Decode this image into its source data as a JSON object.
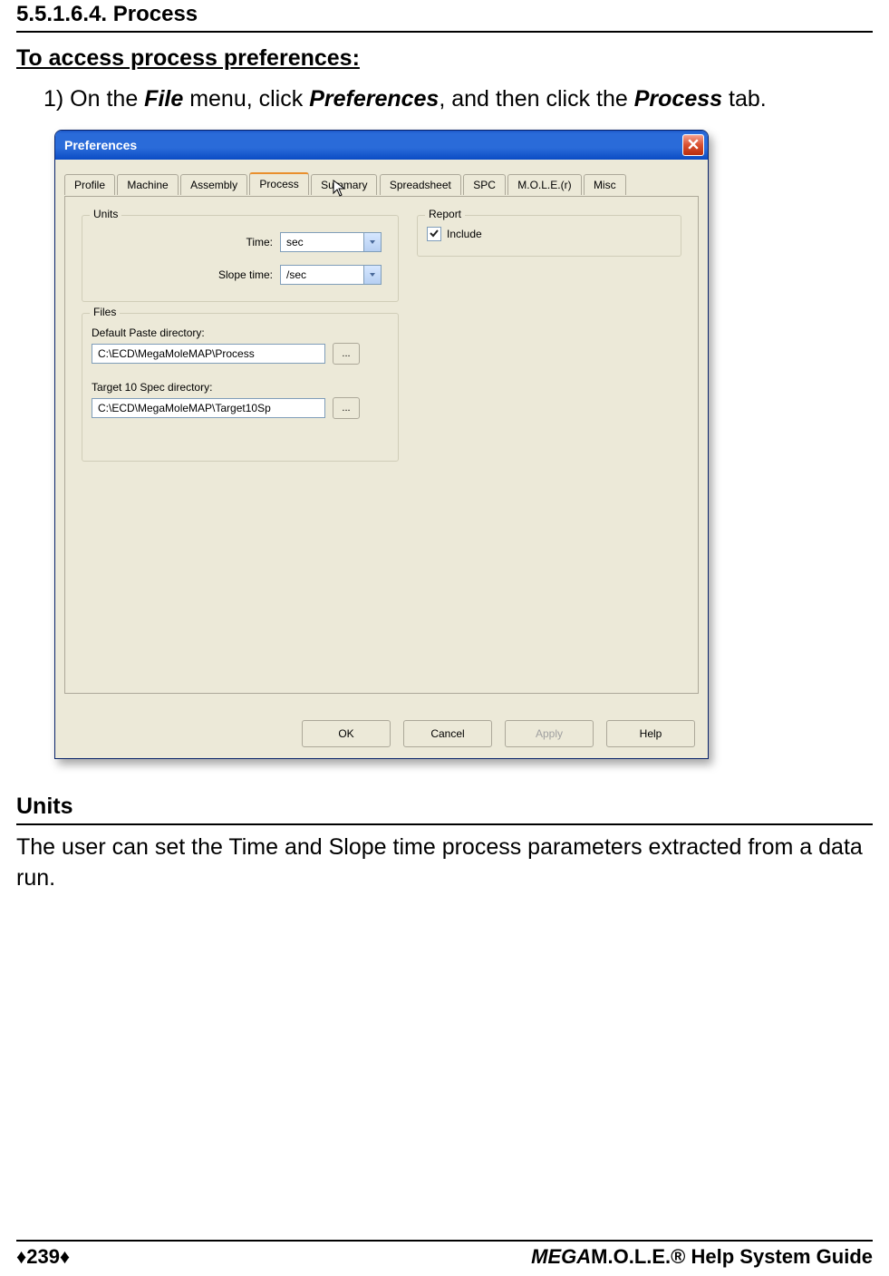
{
  "doc": {
    "section_number": "5.5.1.6.4. Process",
    "access_heading": "To access process preferences:",
    "instruction": {
      "prefix": "1) On the ",
      "bold1": "File",
      "mid1": " menu, click ",
      "bold2": "Preferences",
      "mid2": ", and then click the ",
      "bold3": "Process",
      "suffix": " tab."
    },
    "units_heading": "Units",
    "units_para": "The user can set the Time and Slope time process parameters extracted from a data run.",
    "footer_page": "♦239♦",
    "footer_mega": "MEGA",
    "footer_rest": "M.O.L.E.® Help System Guide"
  },
  "dialog": {
    "title": "Preferences",
    "tabs": [
      "Profile",
      "Machine",
      "Assembly",
      "Process",
      "Summary",
      "Spreadsheet",
      "SPC",
      "M.O.L.E.(r)",
      "Misc"
    ],
    "active_tab_index": 3,
    "units_legend": "Units",
    "report_legend": "Report",
    "files_legend": "Files",
    "time_label": "Time:",
    "time_value": "sec",
    "slope_label": "Slope time:",
    "slope_value": "/sec",
    "include_label": "Include",
    "paste_label": "Default Paste directory:",
    "paste_value": "C:\\ECD\\MegaMoleMAP\\Process",
    "spec_label": "Target 10 Spec directory:",
    "spec_value": "C:\\ECD\\MegaMoleMAP\\Target10Sp",
    "browse_label": "...",
    "buttons": {
      "ok": "OK",
      "cancel": "Cancel",
      "apply": "Apply",
      "help": "Help"
    }
  }
}
